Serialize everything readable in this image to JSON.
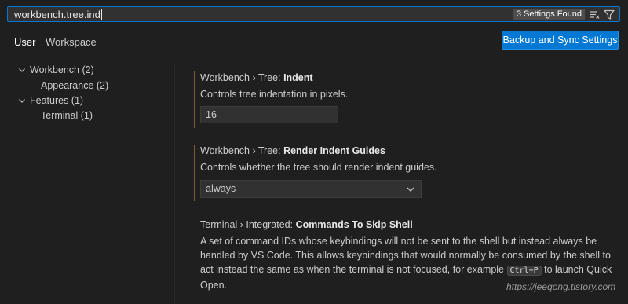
{
  "search": {
    "value": "workbench.tree.ind",
    "result_badge": "3 Settings Found"
  },
  "icons": {
    "clear_filters": "clear-filter-icon",
    "filter": "filter-icon"
  },
  "tabs": [
    {
      "label": "User"
    },
    {
      "label": "Workspace"
    }
  ],
  "sync_button": {
    "label": "Backup and Sync Settings"
  },
  "toc": [
    {
      "label": "Workbench (2)"
    },
    {
      "label": "Appearance (2)"
    },
    {
      "label": "Features (1)"
    },
    {
      "label": "Terminal (1)"
    }
  ],
  "settings": [
    {
      "category": "Workbench › Tree: ",
      "name": "Indent",
      "description": "Controls tree indentation in pixels.",
      "value": "16"
    },
    {
      "category": "Workbench › Tree: ",
      "name": "Render Indent Guides",
      "description": "Controls whether the tree should render indent guides.",
      "value": "always"
    },
    {
      "category": "Terminal › Integrated: ",
      "name": "Commands To Skip Shell",
      "description_lines": [
        "A set of command IDs whose keybindings will not be sent to the shell but instead always be",
        "handled by VS Code. This allows keybindings that would normally be consumed by the shell to",
        "act instead the same as when the terminal is not focused, for example ",
        "Ctrl+P",
        " to launch Quick",
        "Open."
      ]
    }
  ],
  "watermark": "https://jeeqong.tistory.com",
  "colors": {
    "accent": "#0078d4",
    "background": "#1f1f1f",
    "modified_bar": "#7a5c2e"
  }
}
